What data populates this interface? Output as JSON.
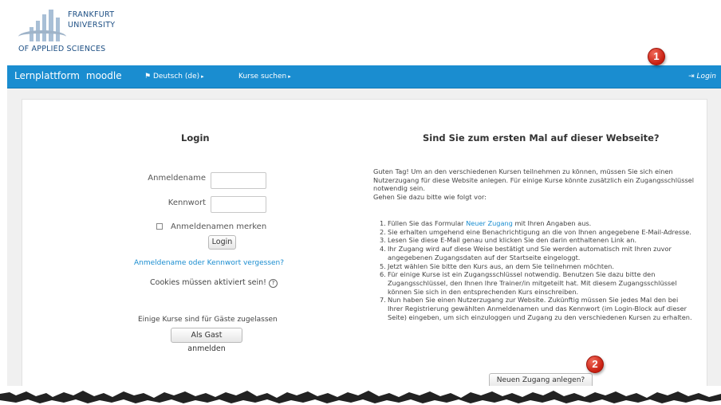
{
  "logo": {
    "line1": "FRANKFURT",
    "line2": "UNIVERSITY",
    "line3": "OF APPLIED SCIENCES"
  },
  "navbar": {
    "brand": "Lernplattform",
    "brand_suffix": "moodle",
    "language": "Deutsch (de)",
    "courses": "Kurse suchen",
    "login": "Login",
    "color": "#1a8dd0"
  },
  "login": {
    "title": "Login",
    "username_label": "Anmeldename",
    "username_value": "",
    "password_label": "Kennwort",
    "password_value": "",
    "remember_label": "Anmeldenamen merken",
    "remember_checked": false,
    "submit_label": "Login",
    "forgot_link": "Anmeldename oder Kennwort vergessen?",
    "cookies_text": "Cookies müssen aktiviert sein!",
    "guests_text": "Einige Kurse sind für Gäste zugelassen",
    "guest_button": "Als Gast anmelden"
  },
  "signup": {
    "title": "Sind Sie zum ersten Mal auf dieser Webseite?",
    "intro": "Guten Tag! Um an den verschiedenen Kursen teilnehmen zu können, müssen Sie sich einen Nutzerzugang für diese Website anlegen. Für einige Kurse könnte zusätzlich ein Zugangsschlüssel notwendig sein.",
    "intro2": "Gehen Sie dazu bitte wie folgt vor:",
    "step1_pre": "Füllen Sie das Formular",
    "step1_link": "Neuer Zugang",
    "step1_post": "mit Ihren Angaben aus.",
    "steps": [
      "Sie erhalten umgehend eine Benachrichtigung an die von Ihnen angegebene E-Mail-Adresse.",
      "Lesen Sie diese E-Mail genau und klicken Sie den darin enthaltenen Link an.",
      "Ihr Zugang wird auf diese Weise bestätigt und Sie werden automatisch mit Ihren zuvor angegebenen Zugangsdaten auf der Startseite eingeloggt.",
      "Jetzt wählen Sie bitte den Kurs aus, an dem Sie teilnehmen möchten.",
      "Für einige Kurse ist ein Zugangsschlüssel notwendig. Benutzen Sie dazu bitte den Zugangsschlüssel, den Ihnen Ihre Trainer/in mitgeteilt hat. Mit diesem Zugangsschlüssel können Sie sich in den entsprechenden Kurs einschreiben.",
      "Nun haben Sie einen Nutzerzugang zur Website. Zukünftig müssen Sie jedes Mal den bei Ihrer Registrierung gewählten Anmeldenamen und das Kennwort (im Login-Block auf dieser Seite) eingeben, um sich einzuloggen und Zugang zu den verschiedenen Kursen zu erhalten."
    ],
    "step_numbers": [
      "1.",
      "2.",
      "3.",
      "4.",
      "5.",
      "6.",
      "7."
    ],
    "button": "Neuen Zugang anlegen?"
  },
  "markers": {
    "one": "1",
    "two": "2",
    "color": "#c81e10"
  }
}
